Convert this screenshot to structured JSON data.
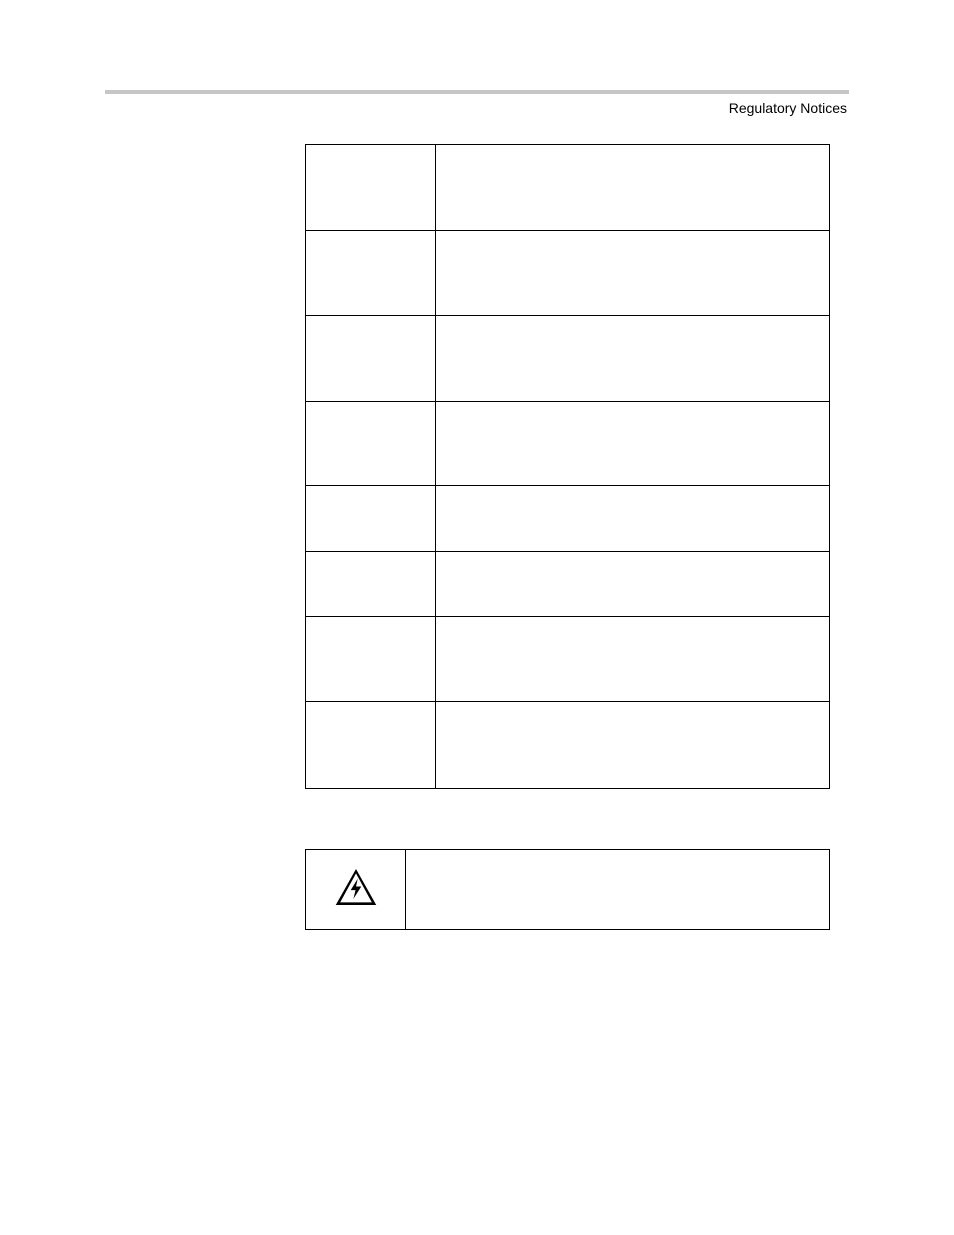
{
  "header": {
    "section_title": "Regulatory Notices"
  },
  "regulatory_table": {
    "rows": [
      {
        "country": "",
        "text": ""
      },
      {
        "country": "",
        "text": ""
      },
      {
        "country": "",
        "text": ""
      },
      {
        "country": "",
        "text": ""
      },
      {
        "country": "",
        "text": ""
      },
      {
        "country": "",
        "text": ""
      },
      {
        "country": "",
        "text": ""
      },
      {
        "country": "",
        "text": ""
      }
    ]
  },
  "warning_box": {
    "icon": "electrical-hazard-icon",
    "text": ""
  }
}
